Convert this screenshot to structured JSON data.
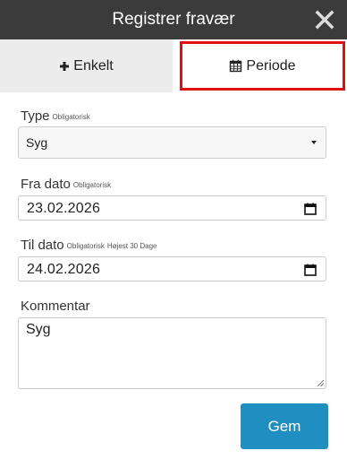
{
  "header": {
    "title": "Registrer fravær",
    "close_icon": "close-icon"
  },
  "tabs": [
    {
      "label": "Enkelt",
      "icon": "plus-icon"
    },
    {
      "label": "Periode",
      "icon": "calendar-icon",
      "highlighted": true
    }
  ],
  "form": {
    "type": {
      "label": "Type",
      "required_note": "Obligatorisk",
      "value": "Syg"
    },
    "from_date": {
      "label": "Fra dato",
      "required_note": "Obligatorisk",
      "value": "23.02.2026"
    },
    "to_date": {
      "label": "Til dato",
      "required_note": "Obligatorisk",
      "max_note": "Højest 30 Dage",
      "value": "24.02.2026"
    },
    "comment": {
      "label": "Kommentar",
      "value": "Syg"
    },
    "save_label": "Gem"
  },
  "colors": {
    "header_bg": "#3b3b3b",
    "tab_inactive_bg": "#ececec",
    "highlight_border": "#e01010",
    "save_button_bg": "#1f8fc1"
  }
}
